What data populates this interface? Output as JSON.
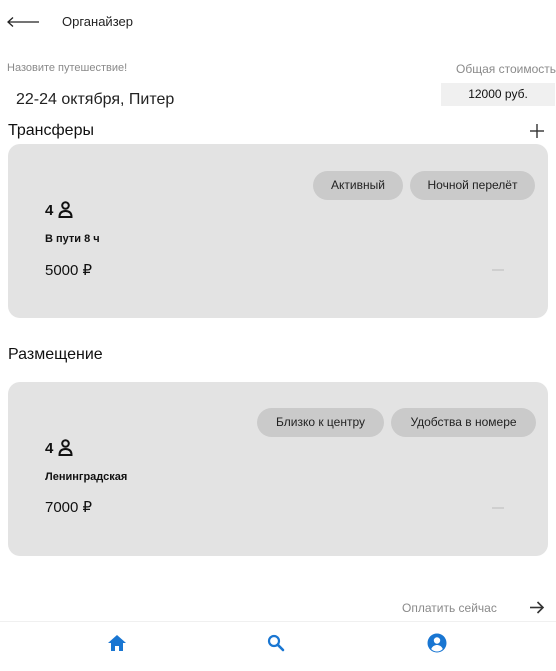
{
  "header": {
    "title": "Органайзер"
  },
  "trip": {
    "name_label": "Назовите путешествие!",
    "name_value": "22-24 октября, Питер",
    "cost_label": "Общая стоимость",
    "cost_value": "12000 руб."
  },
  "transfers": {
    "title": "Трансферы",
    "card": {
      "chips": [
        "Активный",
        "Ночной перелёт"
      ],
      "count": "4",
      "subtitle": "В пути 8 ч",
      "price": "5000 ₽"
    }
  },
  "accommodation": {
    "title": "Размещение",
    "card": {
      "chips": [
        "Близко к центру",
        "Удобства в номере"
      ],
      "count": "4",
      "subtitle": "Ленинградская",
      "price": "7000 ₽"
    }
  },
  "footer": {
    "pay_label": "Оплатить сейчас"
  },
  "colors": {
    "accent": "#1976d2",
    "card": "#e3e3e3",
    "chip": "#cacaca"
  },
  "icons": [
    "back-arrow-icon",
    "plus-icon",
    "person-icon",
    "minus-icon",
    "arrow-right-icon",
    "home-icon",
    "search-icon",
    "account-circle-icon"
  ]
}
